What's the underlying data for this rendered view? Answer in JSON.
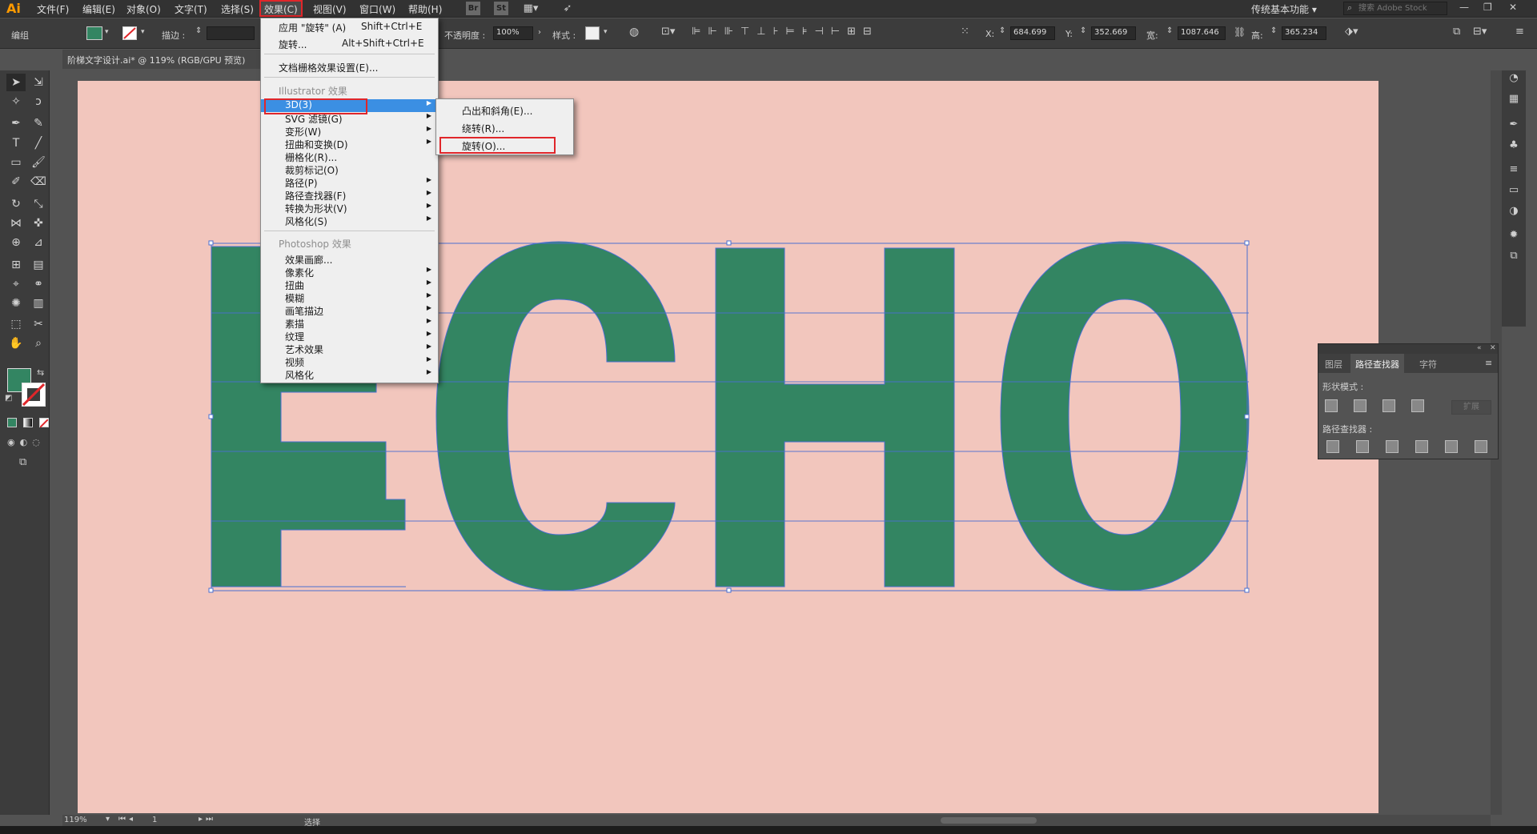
{
  "app": {
    "logo": "Ai"
  },
  "menubar": {
    "items": [
      "文件(F)",
      "编辑(E)",
      "对象(O)",
      "文字(T)",
      "选择(S)",
      "效果(C)",
      "视图(V)",
      "窗口(W)",
      "帮助(H)"
    ],
    "br": "Br",
    "st": "St",
    "workspace": "传统基本功能",
    "stock_placeholder": "搜索 Adobe Stock"
  },
  "controlbar": {
    "group_label": "编组",
    "stroke_label": "描边 :",
    "opacity_label": "不透明度 :",
    "opacity_value": "100%",
    "style_label": "样式 :",
    "x_label": "X:",
    "x_value": "684.699",
    "y_label": "Y:",
    "y_value": "352.669",
    "w_label": "宽:",
    "w_value": "1087.646",
    "h_label": "高:",
    "h_value": "365.234"
  },
  "document": {
    "tab_title": "阶梯文字设计.ai* @ 119% (RGB/GPU 预览)"
  },
  "artwork": {
    "text": "ECHO",
    "fill": "#338562",
    "artboard_color": "#f2c6bd",
    "selection_color": "#4a6fd0"
  },
  "effect_menu": {
    "apply_label": "应用 \"旋转\" (A)",
    "apply_shortcut": "Shift+Ctrl+E",
    "rotate_label": "旋转...",
    "rotate_shortcut": "Alt+Shift+Ctrl+E",
    "raster_settings": "文档栅格效果设置(E)...",
    "illustrator_header": "Illustrator 效果",
    "illustrator_items": [
      "3D(3)",
      "SVG 滤镜(G)",
      "变形(W)",
      "扭曲和变换(D)",
      "栅格化(R)...",
      "裁剪标记(O)",
      "路径(P)",
      "路径查找器(F)",
      "转换为形状(V)",
      "风格化(S)"
    ],
    "photoshop_header": "Photoshop 效果",
    "photoshop_items": [
      "效果画廊...",
      "像素化",
      "扭曲",
      "模糊",
      "画笔描边",
      "素描",
      "纹理",
      "艺术效果",
      "视频",
      "风格化"
    ]
  },
  "submenu_3d": {
    "items": [
      "凸出和斜角(E)...",
      "绕转(R)...",
      "旋转(O)..."
    ]
  },
  "pathfinder_panel": {
    "tabs": [
      "图层",
      "路径查找器",
      "字符"
    ],
    "shape_modes": "形状模式 :",
    "expand": "扩展",
    "pathfinders": "路径查找器 :"
  },
  "status": {
    "zoom": "119%",
    "page": "1",
    "tool": "选择"
  }
}
